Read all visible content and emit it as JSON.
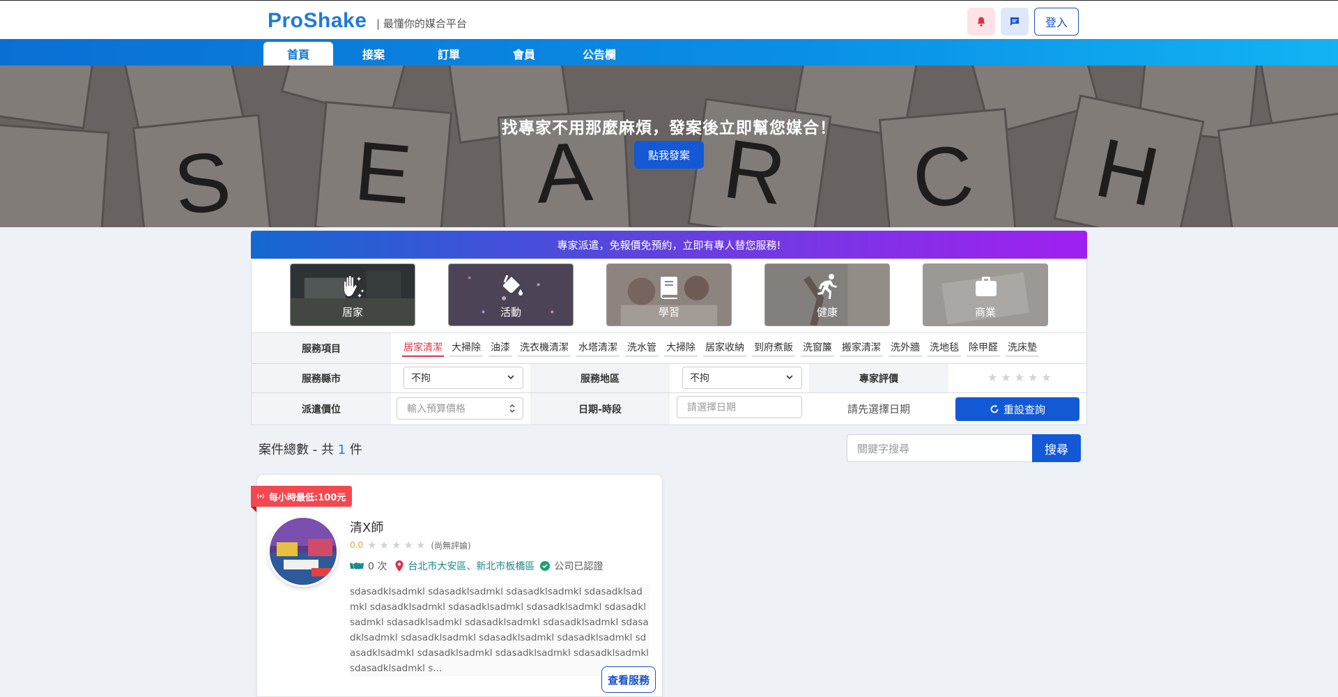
{
  "header": {
    "logo": "ProShake",
    "tagline": "| 最懂你的媒合平台",
    "login_label": "登入"
  },
  "nav": {
    "items": [
      {
        "label": "首頁",
        "active": true
      },
      {
        "label": "接案",
        "active": false
      },
      {
        "label": "訂單",
        "active": false
      },
      {
        "label": "會員",
        "active": false
      },
      {
        "label": "公告欄",
        "active": false
      }
    ]
  },
  "hero": {
    "title": "找專家不用那麼麻煩，發案後立即幫您媒合！",
    "button": "點我發案"
  },
  "promo": "專家派遣，免報價免預約，立即有專人替您服務!",
  "categories": [
    {
      "label": "居家",
      "icon": "cleaning-hand-icon"
    },
    {
      "label": "活動",
      "icon": "paint-bucket-icon"
    },
    {
      "label": "學習",
      "icon": "book-icon"
    },
    {
      "label": "健康",
      "icon": "running-person-icon"
    },
    {
      "label": "商業",
      "icon": "briefcase-icon"
    }
  ],
  "filters": {
    "service_items_label": "服務項目",
    "service_items": [
      "居家清潔",
      "大掃除",
      "油漆",
      "洗衣機清潔",
      "水塔清潔",
      "洗水管",
      "大掃除",
      "居家收納",
      "到府煮飯",
      "洗窗簾",
      "搬家清潔",
      "洗外牆",
      "洗地毯",
      "除甲醛",
      "洗床墊"
    ],
    "city_label": "服務縣市",
    "city_value": "不拘",
    "area_label": "服務地區",
    "area_value": "不拘",
    "rating_label": "專家評價",
    "price_label": "派遣價位",
    "price_placeholder": "輸入預算價格",
    "datetime_label": "日期-時段",
    "date_placeholder": "請選擇日期",
    "slot_hint": "請先選擇日期",
    "reset_label": "重設查詢"
  },
  "results": {
    "total_prefix": "案件總數 - 共",
    "total_count": "1",
    "total_suffix": "件",
    "search_placeholder": "關鍵字搜尋",
    "search_button": "搜尋"
  },
  "card": {
    "ribbon": "每小時最低:100元",
    "name": "清X師",
    "score": "0.0",
    "rating_note": "(尚無評論)",
    "deals": "0 次",
    "location": "台北市大安區、新北市板橋區",
    "certified": "公司已認證",
    "description": "sdasadklsadmkl sdasadklsadmkl sdasadklsadmkl sdasadklsadmkl sdasadklsadmkl sdasadklsadmkl sdasadklsadmkl sdasadklsadmkl sdasadklsadmkl sdasadklsadmkl sdasadklsadmkl sdasadklsadmkl sdasadklsadmkl sdasadklsadmkl sdasadklsadmkl sdasadklsadmkl sdasadklsadmkl sdasadklsadmkl sdasadklsadmkl sdasadklsadmkl s...",
    "view_button": "查看服務"
  },
  "colors": {
    "brand": "#1e7bd6",
    "primary": "#1359d6",
    "accent_red": "#e0304a"
  }
}
